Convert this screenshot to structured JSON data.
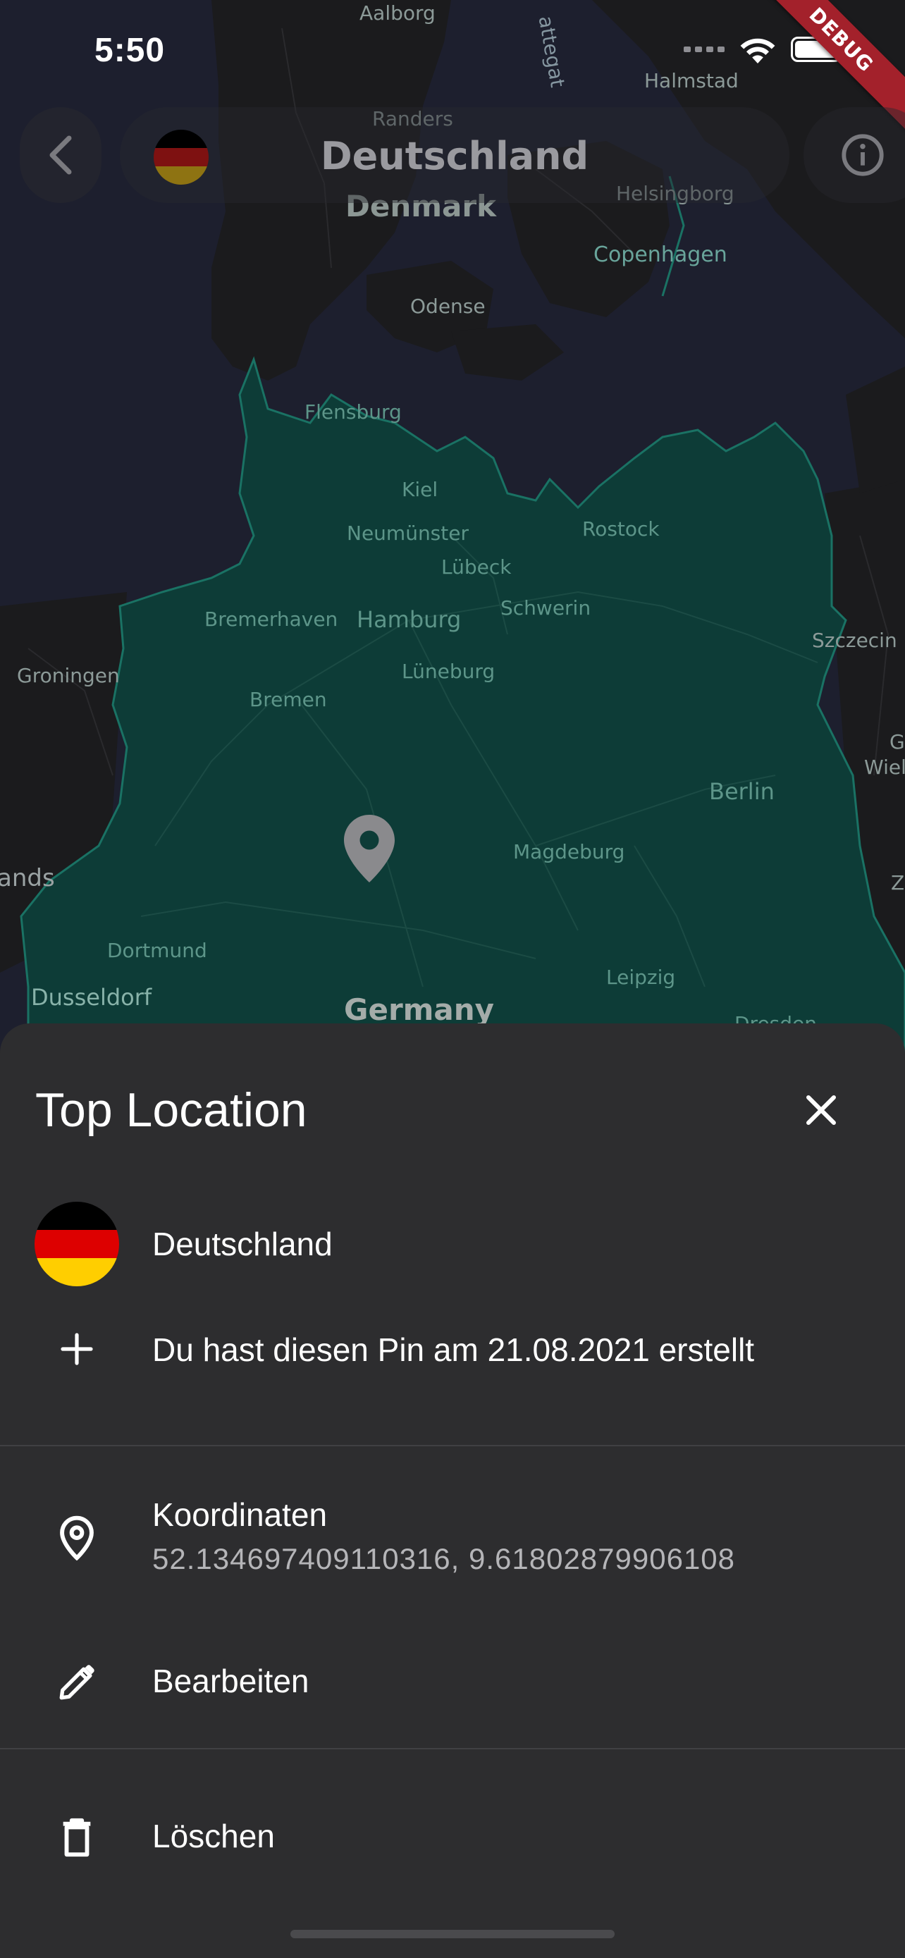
{
  "status_bar": {
    "time": "5:50"
  },
  "debug_banner": "DEBUG",
  "header": {
    "title": "Deutschland"
  },
  "map": {
    "country_labels": [
      "Denmark",
      "Germany",
      "ands"
    ],
    "water_labels": [
      "attegat"
    ],
    "city_labels": [
      "Aalborg",
      "Halmstad",
      "Randers",
      "Helsingborg",
      "Copenhagen",
      "Odense",
      "Flensburg",
      "Kiel",
      "Neumünster",
      "Rostock",
      "Lübeck",
      "Schwerin",
      "Bremerhaven",
      "Hamburg",
      "Szczecin",
      "Groningen",
      "Lüneburg",
      "Bremen",
      "Berlin",
      "Magdeburg",
      "Dortmund",
      "Leipzig",
      "Dusseldorf",
      "Dresden",
      "Wiel",
      "G",
      "Z"
    ]
  },
  "sheet": {
    "title": "Top Location",
    "country_name": "Deutschland",
    "created_text": "Du hast diesen Pin am 21.08.2021 erstellt",
    "coordinates_label": "Koordinaten",
    "coordinates_value": "52.134697409110316, 9.61802879906108",
    "edit_label": "Bearbeiten",
    "delete_label": "Löschen"
  },
  "colors": {
    "flag_black": "#000000",
    "flag_red": "#dd0000",
    "flag_gold": "#ffce00",
    "germany_fill": "#0d3c37",
    "sheet_bg": "#2d2d2f"
  }
}
